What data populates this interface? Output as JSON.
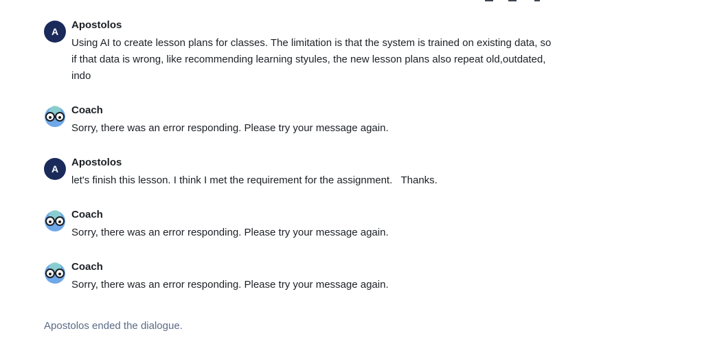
{
  "messages": [
    {
      "role": "user",
      "author": "Apostolos",
      "avatar_letter": "A",
      "text": "Using AI to create lesson plans for classes. The limitation is that the system is trained on existing data, so if that data is wrong, like recommending learning styules, the new lesson plans also repeat old,outdated, indo"
    },
    {
      "role": "coach",
      "author": "Coach",
      "text": "Sorry, there was an error responding. Please try your message again."
    },
    {
      "role": "user",
      "author": "Apostolos",
      "avatar_letter": "A",
      "text": "let's finish this lesson. I think I met the requirement for the assignment.   Thanks."
    },
    {
      "role": "coach",
      "author": "Coach",
      "text": "Sorry, there was an error responding. Please try your message again."
    },
    {
      "role": "coach",
      "author": "Coach",
      "text": "Sorry, there was an error responding. Please try your message again."
    }
  ],
  "status": {
    "ended_text": "Apostolos ended the dialogue."
  },
  "colors": {
    "user_avatar_bg": "#1a2a5a",
    "coach_avatar_bg": "#6fa8e8",
    "status_text": "#5a6a85"
  },
  "icons": {
    "coach_avatar": "robot-glasses-icon"
  }
}
